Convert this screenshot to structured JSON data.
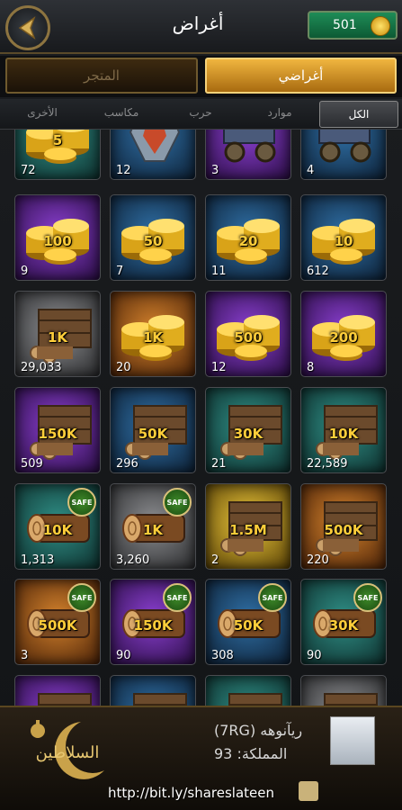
{
  "header": {
    "title": "أغراض",
    "gold_amount": "501"
  },
  "main_tabs": {
    "items_label": "أغراضي",
    "store_label": "المتجر"
  },
  "sub_tabs": [
    "الكل",
    "موارد",
    "حرب",
    "مكاسب",
    "الأخرى"
  ],
  "grid": [
    [
      {
        "label": "5",
        "count": "72",
        "bg": "teal",
        "type": "coins"
      },
      {
        "label": "",
        "count": "12",
        "bg": "blue",
        "type": "armor"
      },
      {
        "label": "",
        "count": "3",
        "bg": "purple",
        "type": "cart"
      },
      {
        "label": "",
        "count": "4",
        "bg": "blue",
        "type": "cart"
      }
    ],
    [
      {
        "label": "100",
        "count": "9",
        "bg": "purple",
        "type": "coins"
      },
      {
        "label": "50",
        "count": "7",
        "bg": "blue",
        "type": "coins"
      },
      {
        "label": "20",
        "count": "11",
        "bg": "blue",
        "type": "coins"
      },
      {
        "label": "10",
        "count": "612",
        "bg": "blue",
        "type": "coins"
      }
    ],
    [
      {
        "label": "1K",
        "count": "29,033",
        "bg": "gray",
        "type": "wood"
      },
      {
        "label": "1K",
        "count": "20",
        "bg": "orange",
        "type": "coins"
      },
      {
        "label": "500",
        "count": "12",
        "bg": "purple",
        "type": "coins"
      },
      {
        "label": "200",
        "count": "8",
        "bg": "purple",
        "type": "coins"
      }
    ],
    [
      {
        "label": "150K",
        "count": "509",
        "bg": "purple",
        "type": "wood"
      },
      {
        "label": "50K",
        "count": "296",
        "bg": "blue",
        "type": "wood"
      },
      {
        "label": "30K",
        "count": "21",
        "bg": "teal",
        "type": "wood"
      },
      {
        "label": "10K",
        "count": "22,589",
        "bg": "teal",
        "type": "wood"
      }
    ],
    [
      {
        "label": "10K",
        "count": "1,313",
        "bg": "teal",
        "type": "log",
        "safe": true
      },
      {
        "label": "1K",
        "count": "3,260",
        "bg": "gray",
        "type": "log",
        "safe": true
      },
      {
        "label": "1.5M",
        "count": "2",
        "bg": "yellow",
        "type": "wood"
      },
      {
        "label": "500K",
        "count": "220",
        "bg": "orange",
        "type": "wood"
      }
    ],
    [
      {
        "label": "500K",
        "count": "3",
        "bg": "orange",
        "type": "log",
        "safe": true
      },
      {
        "label": "150K",
        "count": "90",
        "bg": "purple",
        "type": "log",
        "safe": true
      },
      {
        "label": "50K",
        "count": "308",
        "bg": "blue",
        "type": "log",
        "safe": true
      },
      {
        "label": "30K",
        "count": "90",
        "bg": "teal",
        "type": "log",
        "safe": true
      }
    ],
    [
      {
        "label": "",
        "count": "",
        "bg": "purple",
        "type": "wood"
      },
      {
        "label": "",
        "count": "",
        "bg": "blue",
        "type": "wood"
      },
      {
        "label": "",
        "count": "",
        "bg": "teal",
        "type": "wood"
      },
      {
        "label": "",
        "count": "",
        "bg": "gray",
        "type": "wood"
      }
    ]
  ],
  "safe_badge": "SAFE",
  "footer": {
    "player_name": "ريآنوهه (7RG)",
    "kingdom": "المملكة: 93",
    "url": "http://bit.ly/shareslateen",
    "logo_text": "السلاطين"
  }
}
